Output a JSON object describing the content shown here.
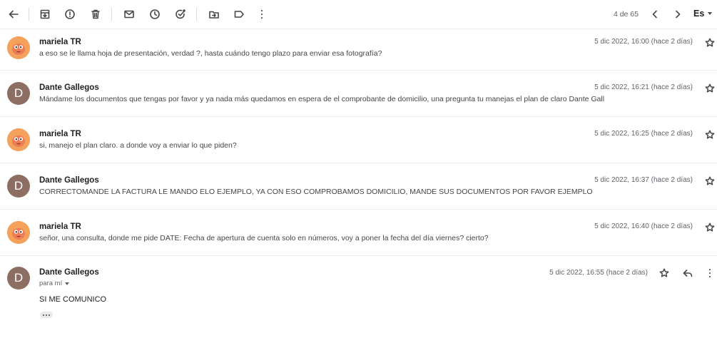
{
  "toolbar": {
    "icons": [
      "back-arrow-icon",
      "archive-icon",
      "report-spam-icon",
      "delete-icon",
      "mark-unread-icon",
      "snooze-icon",
      "add-to-tasks-icon",
      "move-to-icon",
      "label-icon",
      "more-vert-icon"
    ],
    "pager": "4 de 65",
    "language": "Es"
  },
  "messages": [
    {
      "sender": "mariela TR",
      "avatar": "photo",
      "date": "5 dic 2022, 16:00 (hace 2 días)",
      "snippet": "a eso se le llama hoja de presentación, verdad ?, hasta cuándo tengo plazo para enviar esa fotografía?"
    },
    {
      "sender": "Dante Gallegos",
      "avatar": "letter",
      "initial": "D",
      "date": "5 dic 2022, 16:21 (hace 2 días)",
      "snippet": "Mándame los documentos que tengas por favor y ya nada más quedamos en espera de el comprobante de domicilio, una pregunta tu manejas el plan de claro Dante Gall"
    },
    {
      "sender": "mariela TR",
      "avatar": "photo",
      "date": "5 dic 2022, 16:25 (hace 2 días)",
      "snippet": "si, manejo el plan claro. a donde voy a enviar lo que piden?"
    },
    {
      "sender": "Dante Gallegos",
      "avatar": "letter",
      "initial": "D",
      "date": "5 dic 2022, 16:37 (hace 2 días)",
      "snippet": "CORRECTOMANDE LA FACTURA LE MANDO ELO EJEMPLO, YA CON ESO COMPROBAMOS DOMICILIO, MANDE SUS DOCUMENTOS POR FAVOR EJEMPLO"
    },
    {
      "sender": "mariela TR",
      "avatar": "photo",
      "date": "5 dic 2022, 16:40 (hace 2 días)",
      "snippet": "señor, una consulta, donde me pide DATE: Fecha de apertura de cuenta solo en números, voy a poner la fecha del día viernes? cierto?"
    }
  ],
  "expanded": {
    "sender": "Dante Gallegos",
    "initial": "D",
    "date": "5 dic 2022, 16:55 (hace 2 días)",
    "to": "para mí",
    "body": "SI ME COMUNICO"
  }
}
